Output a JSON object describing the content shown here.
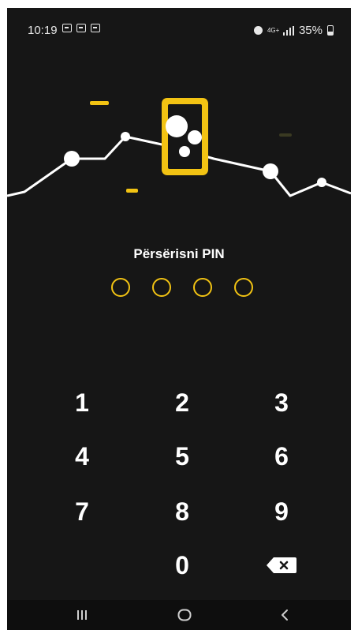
{
  "status_bar": {
    "time": "10:19",
    "network_type": "4G+",
    "battery": "35%"
  },
  "pin_screen": {
    "title": "Përsërisni PIN",
    "pin_length": 4,
    "accent_color": "#f2c313"
  },
  "keypad": {
    "keys": [
      "1",
      "2",
      "3",
      "4",
      "5",
      "6",
      "7",
      "8",
      "9",
      "0"
    ],
    "backspace_icon": "backspace-icon"
  },
  "navigation": {
    "recent_icon": "recent-apps-icon",
    "home_icon": "home-icon",
    "back_icon": "back-icon"
  },
  "colors": {
    "background": "#161616",
    "accent": "#f2c313",
    "text": "#ffffff"
  }
}
